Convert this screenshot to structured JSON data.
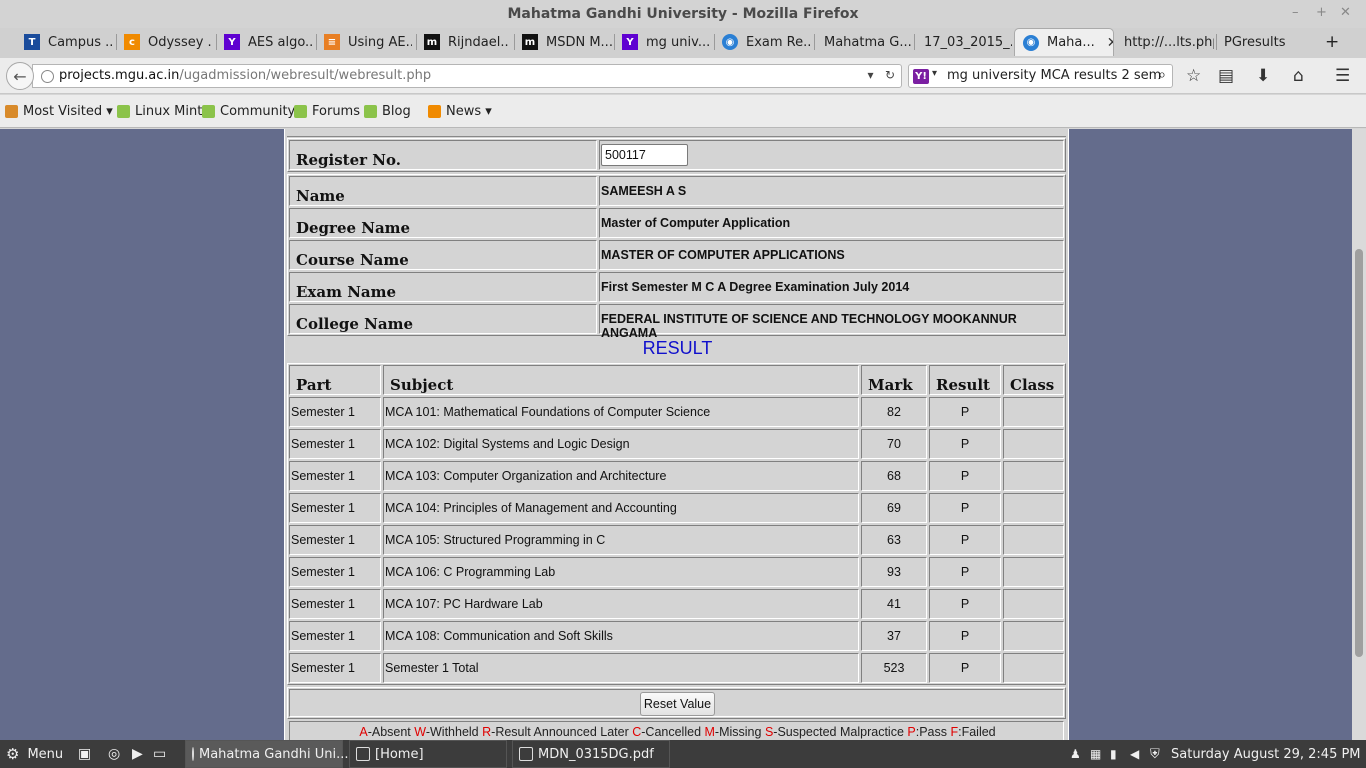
{
  "window": {
    "title": "Mahatma Gandhi University - Mozilla Firefox",
    "min": "–",
    "max": "+",
    "close": "✕"
  },
  "tabs": [
    {
      "label": "Campus ...",
      "icon": "tata-icon",
      "color": "#1a4c9c"
    },
    {
      "label": "Odyssey ...",
      "icon": "odyssey-icon",
      "color": "#f08a00"
    },
    {
      "label": "AES algo...",
      "icon": "yahoo-icon",
      "color": "#5f01d1"
    },
    {
      "label": "Using AE...",
      "icon": "stack-icon",
      "color": "#e87f24"
    },
    {
      "label": "Rijndael...",
      "icon": "m-icon",
      "color": "#111111"
    },
    {
      "label": "MSDN M...",
      "icon": "m-icon",
      "color": "#111111"
    },
    {
      "label": "mg univ...",
      "icon": "yahoo-icon",
      "color": "#5f01d1"
    },
    {
      "label": "Exam Re...",
      "icon": "seal-icon",
      "color": "#2a7fd4"
    },
    {
      "label": "Mahatma G...",
      "icon": "",
      "color": ""
    },
    {
      "label": "17_03_2015_...",
      "icon": "",
      "color": ""
    },
    {
      "label": "Maha...",
      "icon": "seal-icon",
      "color": "#2a7fd4",
      "active": true
    },
    {
      "label": "http://...lts.php",
      "icon": "",
      "color": ""
    },
    {
      "label": "PGresults",
      "icon": "",
      "color": ""
    }
  ],
  "nav": {
    "url_host": "projects.mgu.ac.in",
    "url_path": "/ugadmission/webresult/webresult.php",
    "search_text": "mg university MCA results 2 sem"
  },
  "bookmarks": [
    {
      "label": "Most Visited",
      "dropdown": "▾"
    },
    {
      "label": "Linux Mint"
    },
    {
      "label": "Community"
    },
    {
      "label": "Forums"
    },
    {
      "label": "Blog"
    },
    {
      "label": "News",
      "dropdown": "▾"
    }
  ],
  "form": {
    "register_label": "Register No.",
    "register_value": "500117",
    "fields": [
      {
        "label": "Name",
        "value": "SAMEESH A S"
      },
      {
        "label": "Degree Name",
        "value": "Master of Computer Application"
      },
      {
        "label": "Course Name",
        "value": "MASTER OF COMPUTER APPLICATIONS"
      },
      {
        "label": "Exam Name",
        "value": "First Semester M C A Degree Examination July 2014"
      },
      {
        "label": "College Name",
        "value": "FEDERAL INSTITUTE OF SCIENCE AND TECHNOLOGY MOOKANNUR ANGAMA"
      }
    ]
  },
  "result": {
    "title": "RESULT",
    "headers": {
      "part": "Part",
      "subject": "Subject",
      "mark": "Mark",
      "result": "Result",
      "class": "Class"
    },
    "rows": [
      {
        "part": "Semester 1",
        "subject": "MCA 101: Mathematical Foundations of Computer Science",
        "mark": "82",
        "result": "P",
        "class": ""
      },
      {
        "part": "Semester 1",
        "subject": "MCA 102: Digital Systems and Logic Design",
        "mark": "70",
        "result": "P",
        "class": ""
      },
      {
        "part": "Semester 1",
        "subject": "MCA 103: Computer Organization and Architecture",
        "mark": "68",
        "result": "P",
        "class": ""
      },
      {
        "part": "Semester 1",
        "subject": "MCA 104: Principles of Management and Accounting",
        "mark": "69",
        "result": "P",
        "class": ""
      },
      {
        "part": "Semester 1",
        "subject": "MCA 105: Structured Programming in C",
        "mark": "63",
        "result": "P",
        "class": ""
      },
      {
        "part": "Semester 1",
        "subject": "MCA 106: C Programming Lab",
        "mark": "93",
        "result": "P",
        "class": ""
      },
      {
        "part": "Semester 1",
        "subject": "MCA 107: PC Hardware Lab",
        "mark": "41",
        "result": "P",
        "class": ""
      },
      {
        "part": "Semester 1",
        "subject": "MCA 108: Communication and Soft Skills",
        "mark": "37",
        "result": "P",
        "class": ""
      },
      {
        "part": "Semester 1",
        "subject": "Semester 1 Total",
        "mark": "523",
        "result": "P",
        "class": ""
      }
    ],
    "reset_label": "Reset Value",
    "legend": [
      {
        "key": "A",
        "text": "-Absent "
      },
      {
        "key": "W",
        "text": "-Withheld "
      },
      {
        "key": "R",
        "text": "-Result Announced Later "
      },
      {
        "key": "C",
        "text": "-Cancelled "
      },
      {
        "key": "M",
        "text": "-Missing "
      },
      {
        "key": "S",
        "text": "-Suspected Malpractice "
      },
      {
        "key": "P",
        "text": ":Pass "
      },
      {
        "key": "F",
        "text": ":Failed"
      }
    ]
  },
  "taskbar": {
    "menu_label": "Menu",
    "windows": [
      {
        "label": "Mahatma Gandhi Uni...",
        "active": true
      },
      {
        "label": "[Home]"
      },
      {
        "label": "MDN_0315DG.pdf"
      }
    ],
    "clock": "Saturday August 29,  2:45 PM"
  },
  "colors": {
    "page_bg": "#646c8c",
    "result_title": "#1010cc",
    "legend_key": "#e00000"
  }
}
